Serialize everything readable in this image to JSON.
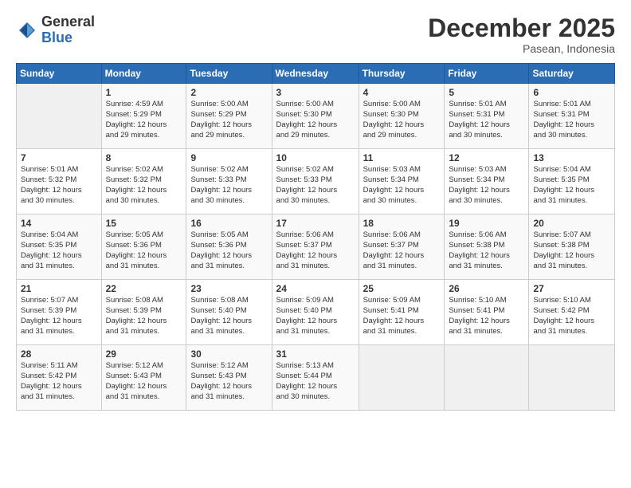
{
  "logo": {
    "general": "General",
    "blue": "Blue"
  },
  "title": "December 2025",
  "location": "Pasean, Indonesia",
  "days_header": [
    "Sunday",
    "Monday",
    "Tuesday",
    "Wednesday",
    "Thursday",
    "Friday",
    "Saturday"
  ],
  "weeks": [
    [
      {
        "day": "",
        "info": ""
      },
      {
        "day": "1",
        "info": "Sunrise: 4:59 AM\nSunset: 5:29 PM\nDaylight: 12 hours\nand 29 minutes."
      },
      {
        "day": "2",
        "info": "Sunrise: 5:00 AM\nSunset: 5:29 PM\nDaylight: 12 hours\nand 29 minutes."
      },
      {
        "day": "3",
        "info": "Sunrise: 5:00 AM\nSunset: 5:30 PM\nDaylight: 12 hours\nand 29 minutes."
      },
      {
        "day": "4",
        "info": "Sunrise: 5:00 AM\nSunset: 5:30 PM\nDaylight: 12 hours\nand 29 minutes."
      },
      {
        "day": "5",
        "info": "Sunrise: 5:01 AM\nSunset: 5:31 PM\nDaylight: 12 hours\nand 30 minutes."
      },
      {
        "day": "6",
        "info": "Sunrise: 5:01 AM\nSunset: 5:31 PM\nDaylight: 12 hours\nand 30 minutes."
      }
    ],
    [
      {
        "day": "7",
        "info": "Sunrise: 5:01 AM\nSunset: 5:32 PM\nDaylight: 12 hours\nand 30 minutes."
      },
      {
        "day": "8",
        "info": "Sunrise: 5:02 AM\nSunset: 5:32 PM\nDaylight: 12 hours\nand 30 minutes."
      },
      {
        "day": "9",
        "info": "Sunrise: 5:02 AM\nSunset: 5:33 PM\nDaylight: 12 hours\nand 30 minutes."
      },
      {
        "day": "10",
        "info": "Sunrise: 5:02 AM\nSunset: 5:33 PM\nDaylight: 12 hours\nand 30 minutes."
      },
      {
        "day": "11",
        "info": "Sunrise: 5:03 AM\nSunset: 5:34 PM\nDaylight: 12 hours\nand 30 minutes."
      },
      {
        "day": "12",
        "info": "Sunrise: 5:03 AM\nSunset: 5:34 PM\nDaylight: 12 hours\nand 30 minutes."
      },
      {
        "day": "13",
        "info": "Sunrise: 5:04 AM\nSunset: 5:35 PM\nDaylight: 12 hours\nand 31 minutes."
      }
    ],
    [
      {
        "day": "14",
        "info": "Sunrise: 5:04 AM\nSunset: 5:35 PM\nDaylight: 12 hours\nand 31 minutes."
      },
      {
        "day": "15",
        "info": "Sunrise: 5:05 AM\nSunset: 5:36 PM\nDaylight: 12 hours\nand 31 minutes."
      },
      {
        "day": "16",
        "info": "Sunrise: 5:05 AM\nSunset: 5:36 PM\nDaylight: 12 hours\nand 31 minutes."
      },
      {
        "day": "17",
        "info": "Sunrise: 5:06 AM\nSunset: 5:37 PM\nDaylight: 12 hours\nand 31 minutes."
      },
      {
        "day": "18",
        "info": "Sunrise: 5:06 AM\nSunset: 5:37 PM\nDaylight: 12 hours\nand 31 minutes."
      },
      {
        "day": "19",
        "info": "Sunrise: 5:06 AM\nSunset: 5:38 PM\nDaylight: 12 hours\nand 31 minutes."
      },
      {
        "day": "20",
        "info": "Sunrise: 5:07 AM\nSunset: 5:38 PM\nDaylight: 12 hours\nand 31 minutes."
      }
    ],
    [
      {
        "day": "21",
        "info": "Sunrise: 5:07 AM\nSunset: 5:39 PM\nDaylight: 12 hours\nand 31 minutes."
      },
      {
        "day": "22",
        "info": "Sunrise: 5:08 AM\nSunset: 5:39 PM\nDaylight: 12 hours\nand 31 minutes."
      },
      {
        "day": "23",
        "info": "Sunrise: 5:08 AM\nSunset: 5:40 PM\nDaylight: 12 hours\nand 31 minutes."
      },
      {
        "day": "24",
        "info": "Sunrise: 5:09 AM\nSunset: 5:40 PM\nDaylight: 12 hours\nand 31 minutes."
      },
      {
        "day": "25",
        "info": "Sunrise: 5:09 AM\nSunset: 5:41 PM\nDaylight: 12 hours\nand 31 minutes."
      },
      {
        "day": "26",
        "info": "Sunrise: 5:10 AM\nSunset: 5:41 PM\nDaylight: 12 hours\nand 31 minutes."
      },
      {
        "day": "27",
        "info": "Sunrise: 5:10 AM\nSunset: 5:42 PM\nDaylight: 12 hours\nand 31 minutes."
      }
    ],
    [
      {
        "day": "28",
        "info": "Sunrise: 5:11 AM\nSunset: 5:42 PM\nDaylight: 12 hours\nand 31 minutes."
      },
      {
        "day": "29",
        "info": "Sunrise: 5:12 AM\nSunset: 5:43 PM\nDaylight: 12 hours\nand 31 minutes."
      },
      {
        "day": "30",
        "info": "Sunrise: 5:12 AM\nSunset: 5:43 PM\nDaylight: 12 hours\nand 31 minutes."
      },
      {
        "day": "31",
        "info": "Sunrise: 5:13 AM\nSunset: 5:44 PM\nDaylight: 12 hours\nand 30 minutes."
      },
      {
        "day": "",
        "info": ""
      },
      {
        "day": "",
        "info": ""
      },
      {
        "day": "",
        "info": ""
      }
    ]
  ]
}
